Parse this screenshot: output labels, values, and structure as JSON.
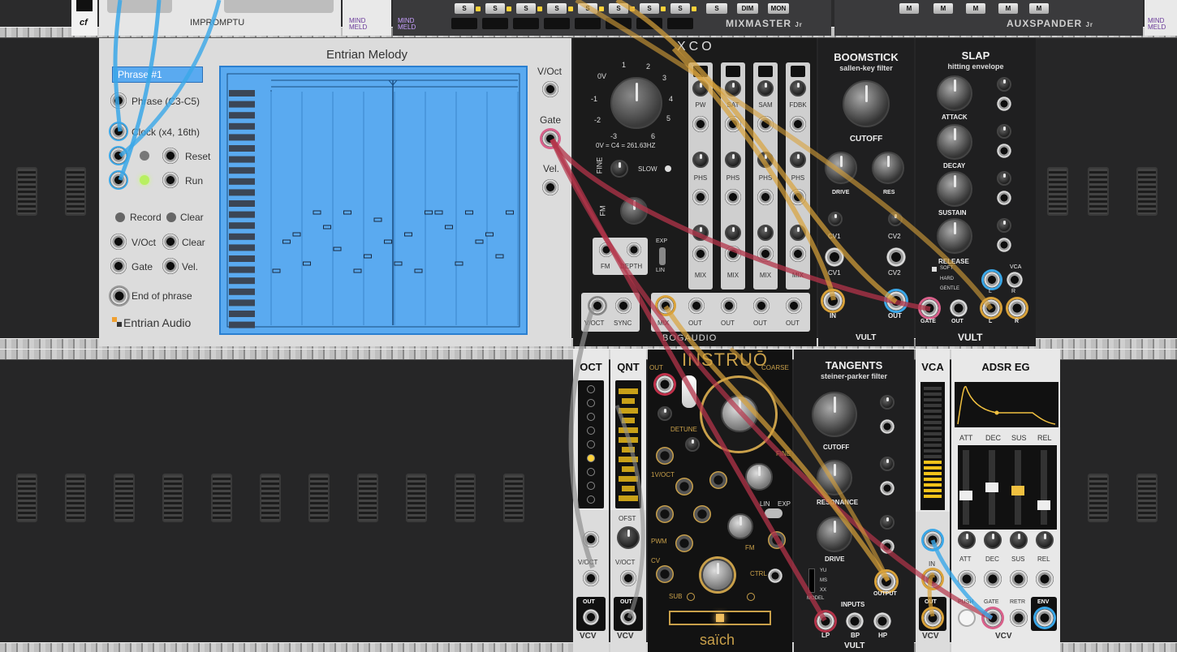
{
  "rack": {
    "top_modules": {
      "cf_label": "cf",
      "impromptu_label": "IMPROMPTU",
      "mindmeld_label": "MIND MELD",
      "mixmaster_label": "MIXMASTER",
      "mixmaster_suffix": "Jr",
      "auxspander_label": "AUXSPANDER",
      "auxspander_suffix": "Jr",
      "solo_label": "S",
      "mute_label": "M",
      "dim_label": "DIM",
      "mon_label": "MON"
    },
    "entrian": {
      "title": "Entrian Melody",
      "phrase_name": "Phrase #1",
      "phrase_range": "Phrase (C3-C5)",
      "clock": "Clock (x4, 16th)",
      "reset": "Reset",
      "run": "Run",
      "record": "Record",
      "clear1": "Clear",
      "voct": "V/Oct",
      "clear2": "Clear",
      "gate": "Gate",
      "vel": "Vel.",
      "end_of_phrase": "End of phrase",
      "brand": "Entrian Audio",
      "out_voct": "V/Oct",
      "out_gate": "Gate",
      "out_vel": "Vel."
    },
    "xco": {
      "title": "XCO",
      "scale": [
        "0V",
        "1",
        "2",
        "3",
        "4",
        "5",
        "6",
        "-1",
        "-2",
        "-3"
      ],
      "freq_note": "0V = C4 = 261.63HZ",
      "fine": "FINE",
      "slow": "SLOW",
      "fm": "FM",
      "fm_btn": "FM",
      "depth": "DEPTH",
      "exp": "EXP",
      "lin": "LIN",
      "voct": "V/OCT",
      "sync": "SYNC",
      "col_pw": "PW",
      "col_sat": "SAT",
      "col_sam": "SAM",
      "col_fdbk": "FDBK",
      "phs": "PHS",
      "mix": "MIX",
      "out": "OUT",
      "brand": "BOGAUDIO"
    },
    "boomstick": {
      "title": "BOOMSTICK",
      "subtitle": "sallen-key filter",
      "cutoff": "CUTOFF",
      "drive": "DRIVE",
      "res": "RES",
      "cv1": "CV1",
      "cv2": "CV2",
      "in": "IN",
      "out": "OUT",
      "brand": "VULT"
    },
    "slap": {
      "title": "SLAP",
      "subtitle": "hitting envelope",
      "attack": "ATTACK",
      "decay": "DECAY",
      "sustain": "SUSTAIN",
      "release": "RELEASE",
      "soft": "SOFT",
      "hard": "HARD",
      "gentle": "GENTLE",
      "vca": "VCA",
      "l": "L",
      "r": "R",
      "gate": "GATE",
      "out": "OUT",
      "brand": "VULT"
    },
    "oct": {
      "title": "OCT",
      "voct": "V/OCT",
      "out": "OUT",
      "brand": "VCV"
    },
    "qnt": {
      "title": "QNT",
      "ofst": "OFST",
      "voct": "V/OCT",
      "out": "OUT",
      "brand": "VCV"
    },
    "instruo": {
      "title": "INSTRUŌ",
      "out": "OUT",
      "coarse": "COARSE",
      "detune": "DETUNE",
      "fine": "FINE",
      "voct": "1V/OCT",
      "lin": "LIN",
      "exp": "EXP",
      "pwm": "PWM",
      "fm": "FM",
      "cv": "CV",
      "ctrl": "CTRL",
      "sub": "SUB",
      "brand": "saïch"
    },
    "tangents": {
      "title": "TANGENTS",
      "subtitle": "steiner-parker filter",
      "cutoff": "CUTOFF",
      "resonance": "RESONANCE",
      "drive": "DRIVE",
      "model": "MODEL",
      "model_opts": [
        "YU",
        "MS",
        "XX"
      ],
      "output": "OUTPUT",
      "inputs": "INPUTS",
      "lp": "LP",
      "bp": "BP",
      "hp": "HP",
      "brand": "VULT"
    },
    "vca": {
      "title": "VCA",
      "in": "IN",
      "out": "OUT",
      "brand": "VCV"
    },
    "adsr": {
      "title": "ADSR EG",
      "att": "ATT",
      "dec": "DEC",
      "sus": "SUS",
      "rel": "REL",
      "push": "PUSH",
      "gate": "GATE",
      "retr": "RETR",
      "env": "ENV",
      "brand": "VCV"
    }
  },
  "colors": {
    "cable_orange": "#d9a23a",
    "cable_red": "#b3344a",
    "cable_blue": "#3aa7e8",
    "cable_grey": "#8f8f8f",
    "entrian_blue": "#5aaaf0"
  },
  "melody_notes": [
    {
      "step": 0,
      "pitch": 1
    },
    {
      "step": 1,
      "pitch": 5
    },
    {
      "step": 2,
      "pitch": 6
    },
    {
      "step": 3,
      "pitch": 2
    },
    {
      "step": 4,
      "pitch": 9
    },
    {
      "step": 5,
      "pitch": 7
    },
    {
      "step": 6,
      "pitch": 4
    },
    {
      "step": 7,
      "pitch": 9
    },
    {
      "step": 8,
      "pitch": 1
    },
    {
      "step": 9,
      "pitch": 3
    },
    {
      "step": 10,
      "pitch": 8
    },
    {
      "step": 11,
      "pitch": 5
    },
    {
      "step": 12,
      "pitch": 2
    },
    {
      "step": 13,
      "pitch": 6
    },
    {
      "step": 14,
      "pitch": 1
    },
    {
      "step": 15,
      "pitch": 9
    },
    {
      "step": 16,
      "pitch": 9
    },
    {
      "step": 17,
      "pitch": 7
    },
    {
      "step": 18,
      "pitch": 2
    },
    {
      "step": 19,
      "pitch": 9
    },
    {
      "step": 20,
      "pitch": 5
    },
    {
      "step": 21,
      "pitch": 6
    },
    {
      "step": 22,
      "pitch": 3
    },
    {
      "step": 23,
      "pitch": 9
    }
  ]
}
